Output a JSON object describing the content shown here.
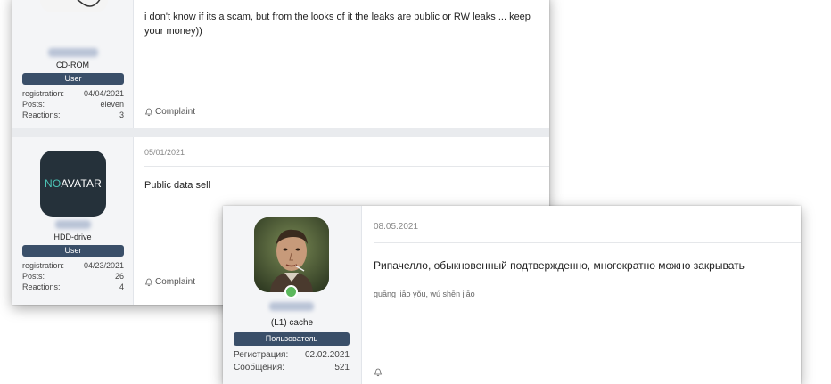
{
  "posts": [
    {
      "rank": "CD-ROM",
      "role": "User",
      "stats": [
        {
          "label": "registration:",
          "value": "04/04/2021"
        },
        {
          "label": "Posts:",
          "value": "eleven"
        },
        {
          "label": "Reactions:",
          "value": "3"
        }
      ],
      "text": "i don't know if its a scam, but from the looks of it the leaks are public or RW leaks ... keep your money))",
      "complaint": "Complaint"
    },
    {
      "avatar_text_no": "NO",
      "avatar_text_avatar": "AVATAR",
      "rank": "HDD-drive",
      "role": "User",
      "date": "05/01/2021",
      "stats": [
        {
          "label": "registration:",
          "value": "04/23/2021"
        },
        {
          "label": "Posts:",
          "value": "26"
        },
        {
          "label": "Reactions:",
          "value": "4"
        }
      ],
      "text": "Public data sell",
      "complaint": "Complaint"
    },
    {
      "rank": "(L1) cache",
      "role": "Пользователь",
      "date": "08.05.2021",
      "stats": [
        {
          "label": "Регистрация:",
          "value": "02.02.2021"
        },
        {
          "label": "Сообщения:",
          "value": "521"
        }
      ],
      "text": "Рипачелло, обыкновенный подтвержденно, многократно можно закрывать",
      "translit": "guāng jiāo yǒu, wú shēn jiāo"
    }
  ],
  "colors": {
    "badge": "#3a4f69",
    "sidebar": "#f4f5f7",
    "online": "#5cb85c"
  }
}
